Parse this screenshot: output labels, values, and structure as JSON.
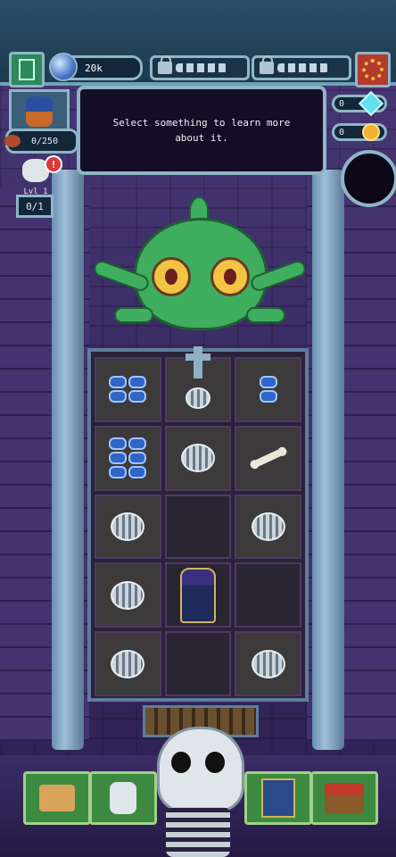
{
  "header": {
    "resource_value": "20k",
    "locked_slots": 2
  },
  "info_panel": {
    "message": "Select something to learn more about it."
  },
  "player": {
    "food": "0/250",
    "level_label": "Lvl 1",
    "progress": "0/1"
  },
  "currencies": {
    "gems": "0",
    "gold": "0"
  },
  "board": {
    "rows": 5,
    "cols": 3,
    "cells": [
      [
        "blue-coins",
        "tombstone-spring",
        "blue-coins-small"
      ],
      [
        "blue-coins-pile",
        "spring",
        "bone"
      ],
      [
        "spring",
        "empty",
        "spring"
      ],
      [
        "spring",
        "wizard",
        "empty"
      ],
      [
        "spring",
        "empty",
        "spring"
      ]
    ]
  },
  "bottom_nav": {
    "buttons": [
      "map-scroll",
      "skeleton-throne",
      "spellbook",
      "shop"
    ]
  },
  "colors": {
    "wall": "#4a3a78",
    "frame": "#8fb6c6",
    "monster": "#3fae5e",
    "nav_button": "#3b8a3f"
  }
}
